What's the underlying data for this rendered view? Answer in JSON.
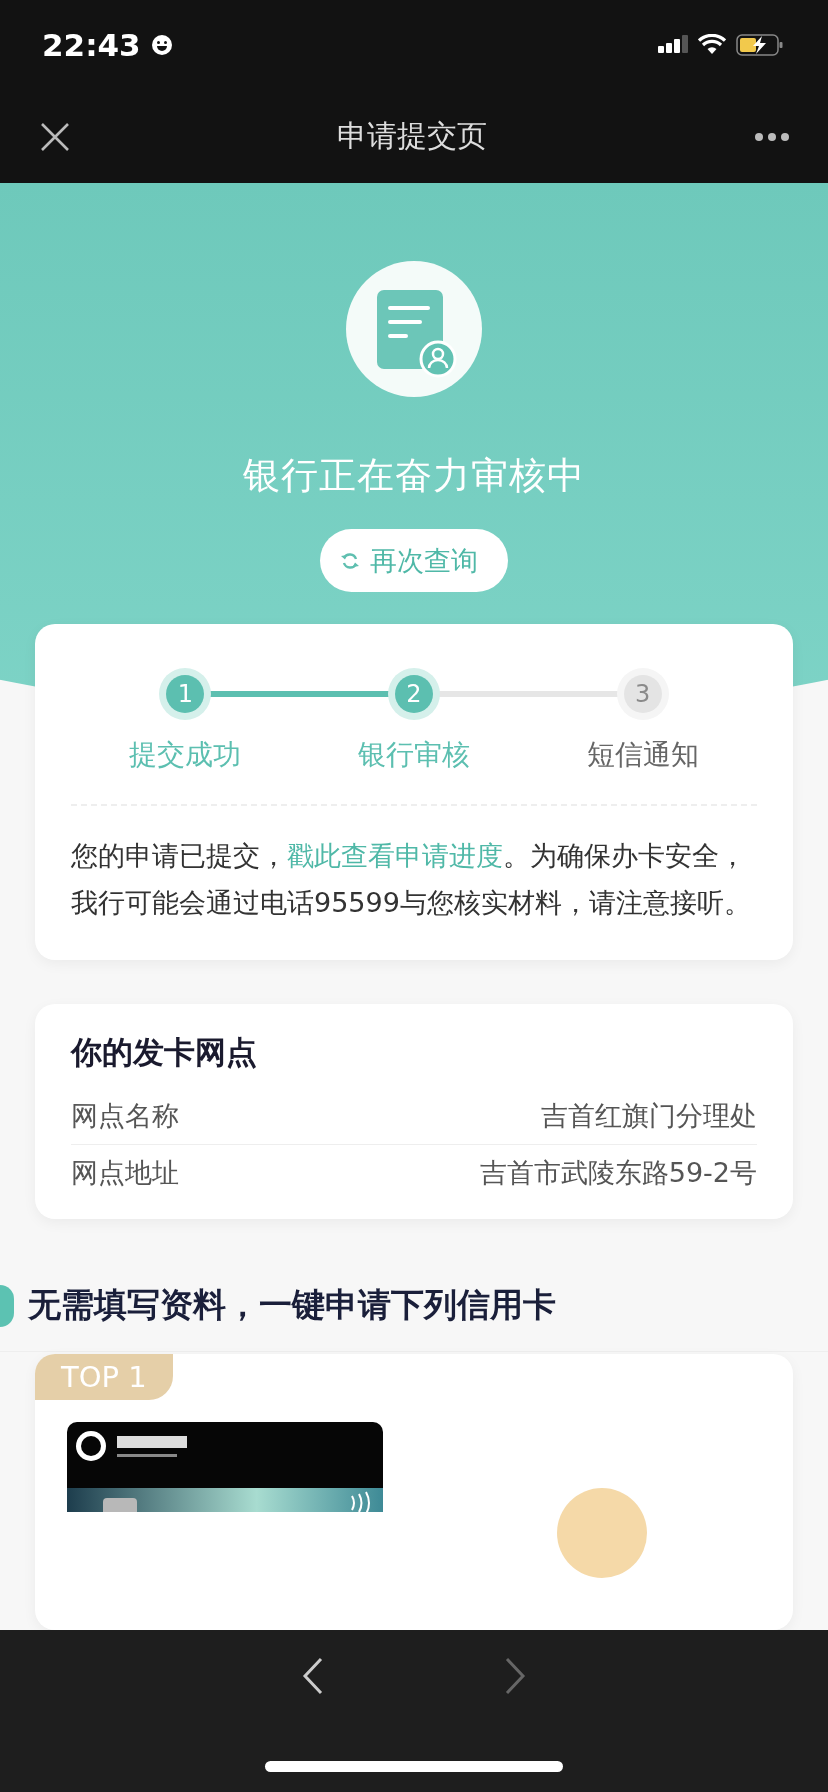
{
  "status_bar": {
    "time": "22:43"
  },
  "nav_bar": {
    "title": "申请提交页"
  },
  "header": {
    "title": "银行正在奋力审核中",
    "refresh_button": "再次查询"
  },
  "progress": {
    "steps": [
      {
        "number": "1",
        "label": "提交成功",
        "completed": true
      },
      {
        "number": "2",
        "label": "银行审核",
        "completed": true
      },
      {
        "number": "3",
        "label": "短信通知",
        "completed": false
      }
    ],
    "message": {
      "before": "您的申请已提交，",
      "link": "戳此查看申请进度",
      "after": "。为确保办卡安全，我行可能会通过电话95599与您核实材料，请注意接听。"
    }
  },
  "branch": {
    "title": "你的发卡网点",
    "rows": [
      {
        "label": "网点名称",
        "value": "吉首红旗门分理处"
      },
      {
        "label": "网点地址",
        "value": "吉首市武陵东路59-2号"
      }
    ]
  },
  "recommend": {
    "title": "无需填写资料，一键申请下列信用卡",
    "items": [
      {
        "rank": "TOP 1",
        "kind": "picture"
      }
    ]
  },
  "browser_bar": {
    "back": {
      "disabled": false
    },
    "forward": {
      "disabled": true
    }
  }
}
